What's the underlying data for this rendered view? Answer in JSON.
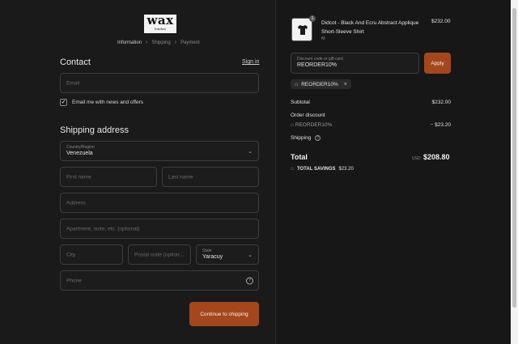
{
  "brand": {
    "logo_main": "wax",
    "logo_sub": "london"
  },
  "breadcrumbs": [
    {
      "label": "Information",
      "active": true
    },
    {
      "label": "Shipping",
      "active": false
    },
    {
      "label": "Payment",
      "active": false
    }
  ],
  "contact": {
    "heading": "Contact",
    "signin_label": "Sign in",
    "email_placeholder": "Email",
    "newsletter_label": "Email me with news and offers",
    "newsletter_checked": true
  },
  "shipping": {
    "heading": "Shipping address",
    "country_label": "Country/Region",
    "country_value": "Venezuela",
    "first_name_placeholder": "First name",
    "last_name_placeholder": "Last name",
    "address_placeholder": "Address",
    "apartment_placeholder": "Apartment, suite, etc. (optional)",
    "city_placeholder": "City",
    "postal_placeholder": "Postal code (option...",
    "state_label": "State",
    "state_value": "Yaracuy",
    "phone_placeholder": "Phone",
    "continue_label": "Continue to shipping"
  },
  "order": {
    "product": {
      "name": "Didcot - Black And Ecru Abstract Applique Short-Sleeve Shirt",
      "variant": "M",
      "quantity": "1",
      "price": "$232.00"
    },
    "discount": {
      "label": "Discount code or gift card",
      "value": "REORDER10%",
      "apply_label": "Apply",
      "applied_code": "REORDER10%"
    },
    "summary": {
      "subtotal_label": "Subtotal",
      "subtotal_value": "$232.00",
      "order_discount_label": "Order discount",
      "discount_code": "REORDER10%",
      "discount_value": "− $23.20",
      "shipping_label": "Shipping",
      "total_label": "Total",
      "currency": "USD",
      "total_value": "$208.80",
      "savings_label": "TOTAL SAVINGS",
      "savings_value": "$23.20"
    }
  },
  "colors": {
    "accent": "#a4471c",
    "background": "#1a1a1a"
  }
}
